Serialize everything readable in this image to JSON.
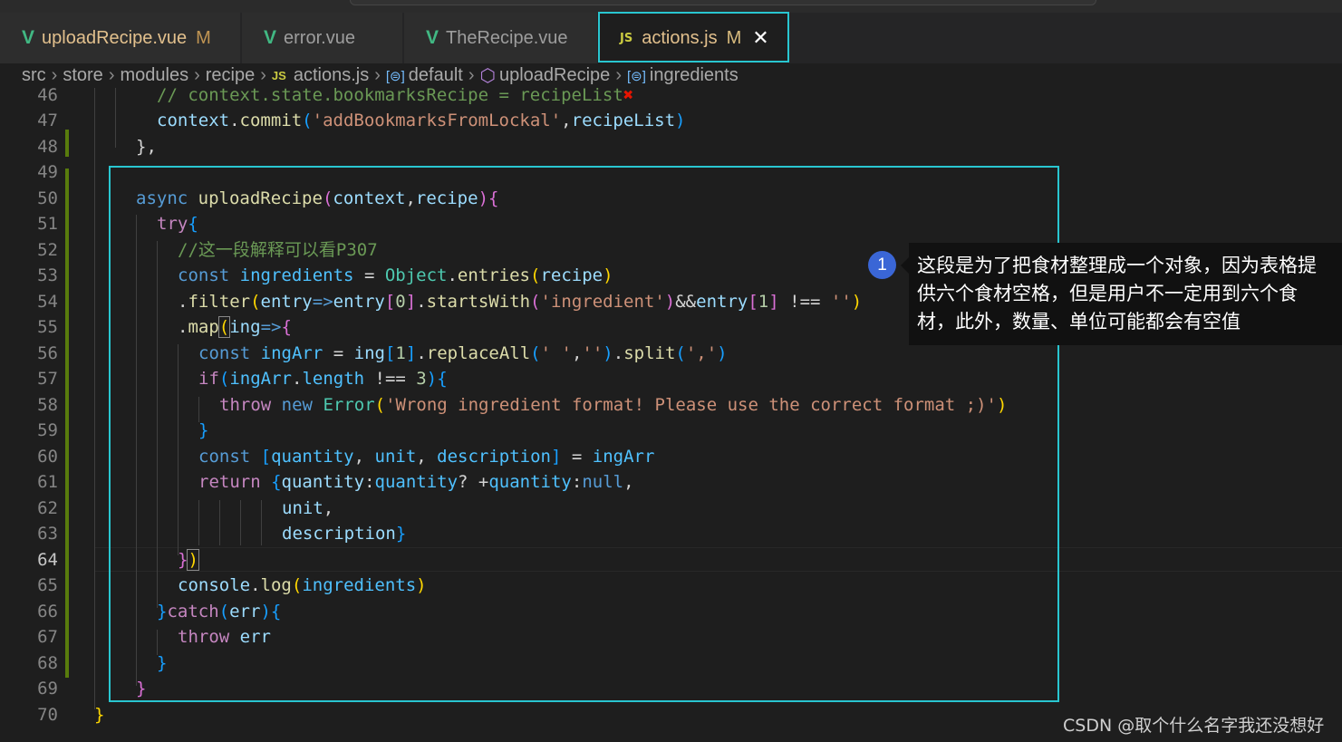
{
  "tabs": [
    {
      "label": "uploadRecipe.vue",
      "icon": "vue-icon",
      "modified": "M"
    },
    {
      "label": "error.vue",
      "icon": "vue-icon",
      "modified": ""
    },
    {
      "label": "TheRecipe.vue",
      "icon": "vue-icon",
      "modified": ""
    },
    {
      "label": "actions.js",
      "icon": "js-icon",
      "modified": "M",
      "active": true
    }
  ],
  "icons": {
    "vue": "V",
    "js": "JS",
    "close": "✕",
    "symbol_variable": "[⊜]",
    "symbol_method": "⬡",
    "error_mark": "✖"
  },
  "breadcrumbs": [
    "src",
    "store",
    "modules",
    "recipe",
    "actions.js",
    "default",
    "uploadRecipe",
    "ingredients"
  ],
  "line_numbers": [
    "46",
    "47",
    "48",
    "49",
    "50",
    "51",
    "52",
    "53",
    "54",
    "55",
    "56",
    "57",
    "58",
    "59",
    "60",
    "61",
    "62",
    "63",
    "64",
    "65",
    "66",
    "67",
    "68",
    "69",
    "70"
  ],
  "code": {
    "l46": {
      "comment": "// context.state.bookmarksRecipe = recipeList"
    },
    "l47": {
      "obj": "context",
      "dot": ".",
      "fn": "commit",
      "open": "(",
      "str": "'addBookmarksFromLockal'",
      "comma": ",",
      "arg": "recipeList",
      "close": ")"
    },
    "l48": {
      "text": "},"
    },
    "l50": {
      "kw": "async",
      "fn": "uploadRecipe",
      "open": "(",
      "p1": "context",
      "comma": ",",
      "p2": "recipe",
      "close": ")",
      "brace": "{"
    },
    "l51": {
      "kw": "try",
      "brace": "{"
    },
    "l52": {
      "comment": "//这一段解释可以看P307"
    },
    "l53": {
      "kw": "const",
      "name": "ingredients",
      "eq": " = ",
      "cls": "Object",
      "dot": ".",
      "fn": "entries",
      "open": "(",
      "arg": "recipe",
      "close": ")"
    },
    "l54": {
      "dot": ".",
      "fn": "filter",
      "open": "(",
      "a": "entry",
      "arrow": "=>",
      "b": "entry",
      "ob": "[",
      "idx0": "0",
      "cb": "]",
      "dot2": ".",
      "fn2": "startsWith",
      "open2": "(",
      "str": "'ingredient'",
      "close2": ")",
      "and": "&&",
      "c": "entry",
      "ob2": "[",
      "idx1": "1",
      "cb2": "]",
      "neq": " !== ",
      "str2": "''",
      "close": ")"
    },
    "l55": {
      "dot": ".",
      "fn": "map",
      "open": "(",
      "a": "ing",
      "arrow": "=>",
      "brace": "{"
    },
    "l56": {
      "kw": "const",
      "name": "ingArr",
      "eq": " = ",
      "obj": "ing",
      "ob": "[",
      "idx": "1",
      "cb": "]",
      "dot": ".",
      "fn": "replaceAll",
      "open": "(",
      "s1": "' '",
      "comma": ",",
      "s2": "''",
      "close": ")",
      "dot2": ".",
      "fn2": "split",
      "open2": "(",
      "s3": "','",
      "close2": ")"
    },
    "l57": {
      "kw": "if",
      "open": "(",
      "obj": "ingArr",
      "dot": ".",
      "prop": "length",
      "neq": " !== ",
      "num": "3",
      "close": ")",
      "brace": "{"
    },
    "l58": {
      "kw": "throw",
      "kw2": "new",
      "cls": "Error",
      "open": "(",
      "str": "'Wrong ingredient format! Please use the correct format ;)'",
      "close": ")"
    },
    "l59": {
      "brace": "}"
    },
    "l60": {
      "kw": "const",
      "ob": "[",
      "a": "quantity",
      "c1": ", ",
      "b": "unit",
      "c2": ", ",
      "c": "description",
      "cb": "]",
      "eq": " = ",
      "val": "ingArr"
    },
    "l61": {
      "kw": "return",
      "brace": "{",
      "k1": "quantity",
      "colon": ":",
      "v1": "quantity",
      "q": "? +",
      "v2": "quantity",
      "colon2": ":",
      "nul": "null",
      "comma": ","
    },
    "l62": {
      "k": "unit",
      "comma": ","
    },
    "l63": {
      "k": "description",
      "brace": "}"
    },
    "l64": {
      "brace": "}",
      "paren": ")"
    },
    "l65": {
      "obj": "console",
      "dot": ".",
      "fn": "log",
      "open": "(",
      "arg": "ingredients",
      "close": ")"
    },
    "l66": {
      "brace": "}",
      "kw": "catch",
      "open": "(",
      "arg": "err",
      "close": ")",
      "brace2": "{"
    },
    "l67": {
      "kw": "throw",
      "arg": "err"
    },
    "l68": {
      "brace": "}"
    },
    "l69": {
      "brace": "}"
    },
    "l70": {
      "brace": "}"
    }
  },
  "annotation": {
    "badge": "1",
    "text": "这段是为了把食材整理成一个对象，因为表格提供六个食材空格，但是用户不一定用到六个食材，此外，数量、单位可能都会有空值"
  },
  "watermark": "CSDN @取个什么名字我还没想好",
  "colors": {
    "highlight_box": "#29c6d0",
    "badge": "#3a66d6",
    "git_modified": "#587c0c"
  }
}
